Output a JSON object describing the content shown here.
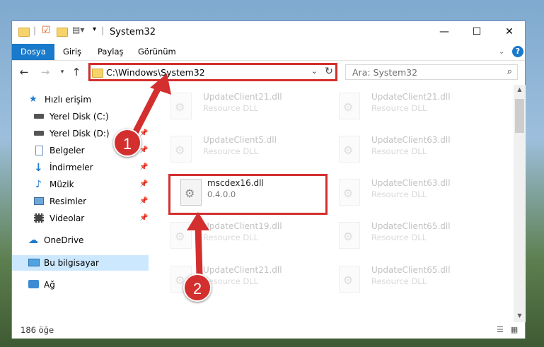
{
  "window": {
    "title": "System32"
  },
  "ribbon": {
    "tabs": [
      "Dosya",
      "Giriş",
      "Paylaş",
      "Görünüm"
    ]
  },
  "address": {
    "path": "C:\\Windows\\System32"
  },
  "search": {
    "placeholder": "Ara: System32"
  },
  "sidebar": {
    "items": [
      {
        "label": "Hızlı erişim",
        "icon": "star-icon"
      },
      {
        "label": "Yerel Disk (C:)",
        "icon": "drive-icon"
      },
      {
        "label": "Yerel Disk (D:)",
        "icon": "drive-icon"
      },
      {
        "label": "Belgeler",
        "icon": "documents-icon"
      },
      {
        "label": "İndirmeler",
        "icon": "download-icon"
      },
      {
        "label": "Müzik",
        "icon": "music-icon"
      },
      {
        "label": "Resimler",
        "icon": "pictures-icon"
      },
      {
        "label": "Videolar",
        "icon": "video-icon"
      },
      {
        "label": "OneDrive",
        "icon": "cloud-icon"
      },
      {
        "label": "Bu bilgisayar",
        "icon": "computer-icon"
      },
      {
        "label": "Ağ",
        "icon": "network-icon"
      }
    ]
  },
  "files": [
    {
      "name": "UpdateClient21.dll",
      "type": "Resource DLL"
    },
    {
      "name": "UpdateClient21.dll",
      "type": "Resource DLL"
    },
    {
      "name": "UpdateClient5.dll",
      "type": "Resource DLL"
    },
    {
      "name": "UpdateClient63.dll",
      "type": "Resource DLL"
    },
    {
      "name": "mscdex16.dll",
      "type": "0.4.0.0"
    },
    {
      "name": "UpdateClient63.dll",
      "type": "Resource DLL"
    },
    {
      "name": "UpdateClient19.dll",
      "type": "Resource DLL"
    },
    {
      "name": "UpdateClient65.dll",
      "type": "Resource DLL"
    },
    {
      "name": "UpdateClient21.dll",
      "type": "Resource DLL"
    },
    {
      "name": "UpdateClient65.dll",
      "type": "Resource DLL"
    }
  ],
  "status": {
    "count": "186 öğe"
  },
  "annotations": {
    "badge1": "1",
    "badge2": "2",
    "color": "#d32f2f"
  }
}
